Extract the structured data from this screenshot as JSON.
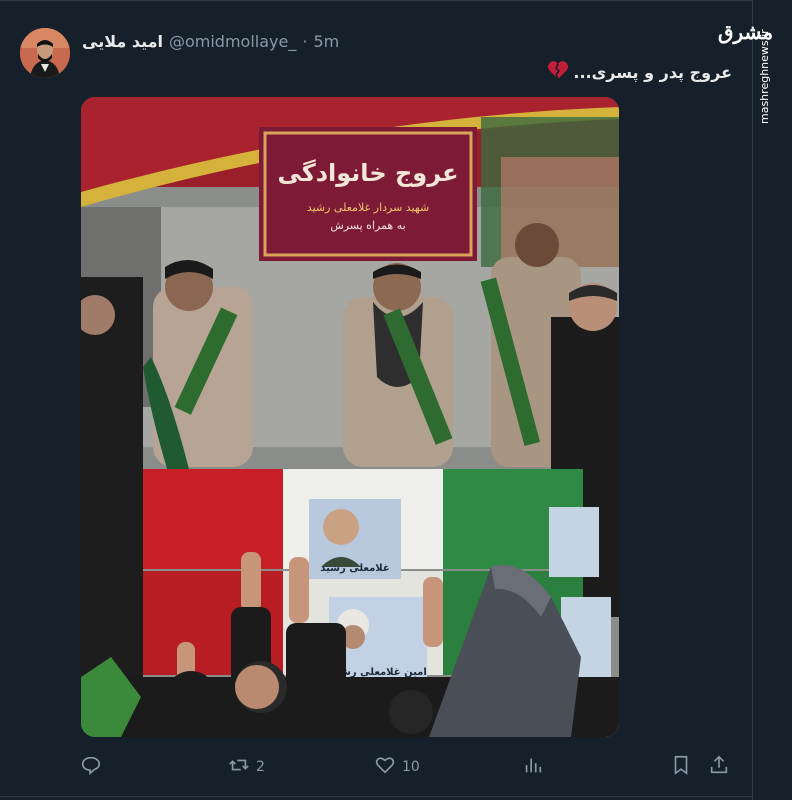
{
  "tweet": {
    "author_name": "امید ملایی",
    "handle": "@omidmollaye_",
    "separator": "·",
    "time": "5m",
    "text": "عروج پدر و پسری...",
    "emoji_icon": "broken-heart-icon"
  },
  "media": {
    "banner_title": "عروج خانوادگی",
    "banner_line1": "شهید سردار غلامعلی رشید",
    "banner_line2": "به همراه پسرش",
    "poster_text_1": "غلامعلی رشید",
    "poster_text_2": "امین غلامعلی رشید"
  },
  "actions": {
    "reply_count": "",
    "retweet_count": "2",
    "like_count": "10",
    "views_count": ""
  },
  "watermark": {
    "logo": "مشرق",
    "site": "mashreghnews.ir"
  },
  "colors": {
    "background": "#15202b",
    "muted": "#8b98a5",
    "broken_heart": "#c21e3a"
  }
}
